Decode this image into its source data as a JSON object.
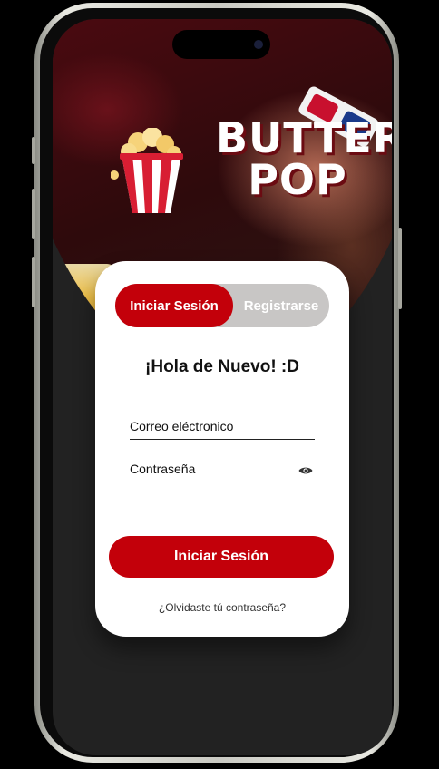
{
  "brand": {
    "logo_line1": "BUTTER",
    "logo_line2": "POP",
    "accent_color": "#c3000a"
  },
  "auth_tabs": {
    "login_label": "Iniciar Sesión",
    "register_label": "Registrarse",
    "active": "login"
  },
  "greeting": "¡Hola de Nuevo! :D",
  "form": {
    "email_placeholder": "Correo eléctronico",
    "password_placeholder": "Contraseña",
    "password_icon": "eye-icon"
  },
  "submit_label": "Iniciar Sesión",
  "forgot_link": "¿Olvidaste tú contraseña?"
}
